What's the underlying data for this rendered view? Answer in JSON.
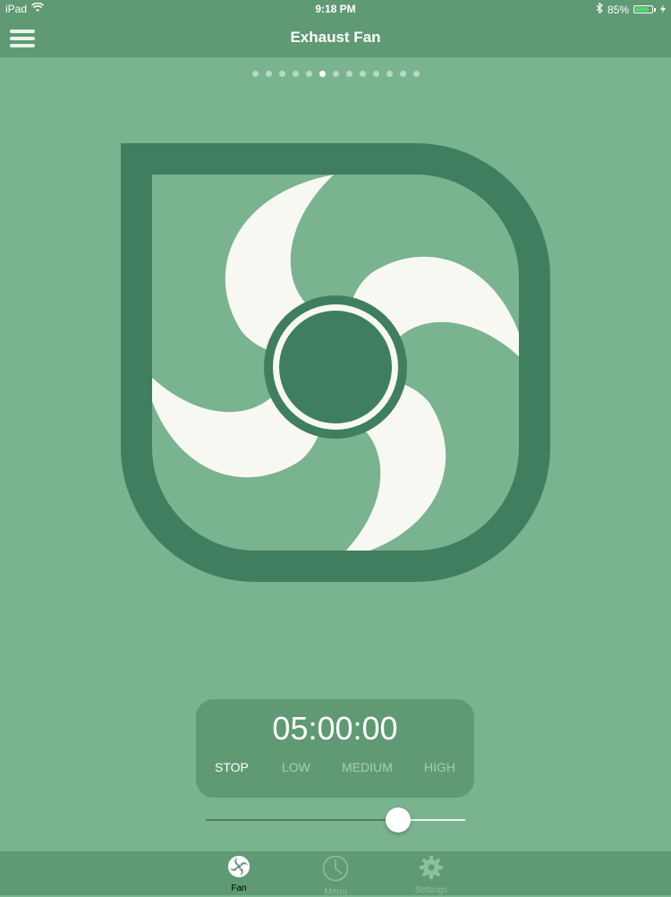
{
  "status_bar": {
    "device": "iPad",
    "time": "9:18 PM",
    "battery_percent": "85%",
    "battery_level": 0.85,
    "icons": [
      "wifi-icon",
      "bluetooth-icon",
      "battery-icon",
      "charging-icon"
    ]
  },
  "nav": {
    "title": "Exhaust Fan",
    "menu_icon": "hamburger-menu-icon"
  },
  "pager": {
    "total": 13,
    "active_index": 5
  },
  "fan": {
    "icon": "exhaust-fan-illustration",
    "frame_color": "#3f7e5f",
    "blade_color": "#f8f8f3",
    "hub_color": "#3f7e5f"
  },
  "control": {
    "timer": "05:00:00",
    "speeds": [
      {
        "label": "STOP",
        "active": true
      },
      {
        "label": "LOW",
        "active": false
      },
      {
        "label": "MEDIUM",
        "active": false
      },
      {
        "label": "HIGH",
        "active": false
      }
    ],
    "slider_value": 0.74
  },
  "tabs": [
    {
      "label": "Fan",
      "icon": "fan-icon",
      "active": true
    },
    {
      "label": "Menu",
      "icon": "clock-icon",
      "active": false
    },
    {
      "label": "Settings",
      "icon": "gear-icon",
      "active": false
    }
  ],
  "colors": {
    "background": "#7ab38f",
    "bar": "#5f9a74",
    "accent": "#3f7e5f"
  }
}
